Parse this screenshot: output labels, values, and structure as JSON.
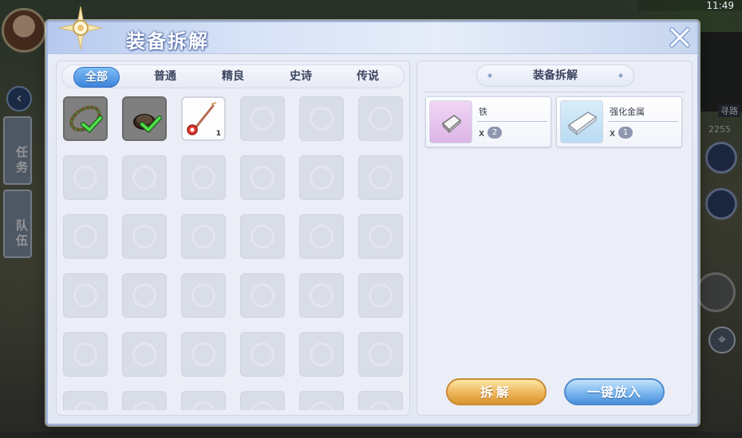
{
  "status_bar": {
    "time": "11:49"
  },
  "background": {
    "side_buttons": [
      "任务",
      "队伍"
    ],
    "minimap_label": "寻路",
    "counter": "2255"
  },
  "dialog": {
    "title": "装备拆解",
    "tabs": [
      {
        "label": "全部",
        "active": true
      },
      {
        "label": "普通",
        "active": false
      },
      {
        "label": "精良",
        "active": false
      },
      {
        "label": "史诗",
        "active": false
      },
      {
        "label": "传说",
        "active": false
      }
    ],
    "inventory": {
      "columns": 6,
      "slots": [
        {
          "state": "selected",
          "item": "thorn-ring"
        },
        {
          "state": "selected",
          "item": "dark-ring"
        },
        {
          "state": "item",
          "item": "red-staff",
          "quantity": "1"
        }
      ]
    },
    "dismantle_panel": {
      "header": "装备拆解",
      "materials": [
        {
          "name": "铁",
          "x": "x",
          "count": "2",
          "icon": "iron-icon",
          "frame": "purple"
        },
        {
          "name": "强化金属",
          "x": "x",
          "count": "1",
          "icon": "reinforced-metal-icon",
          "frame": "blue"
        }
      ],
      "dismantle_button": "拆解",
      "put_all_button": "一键放入"
    }
  }
}
